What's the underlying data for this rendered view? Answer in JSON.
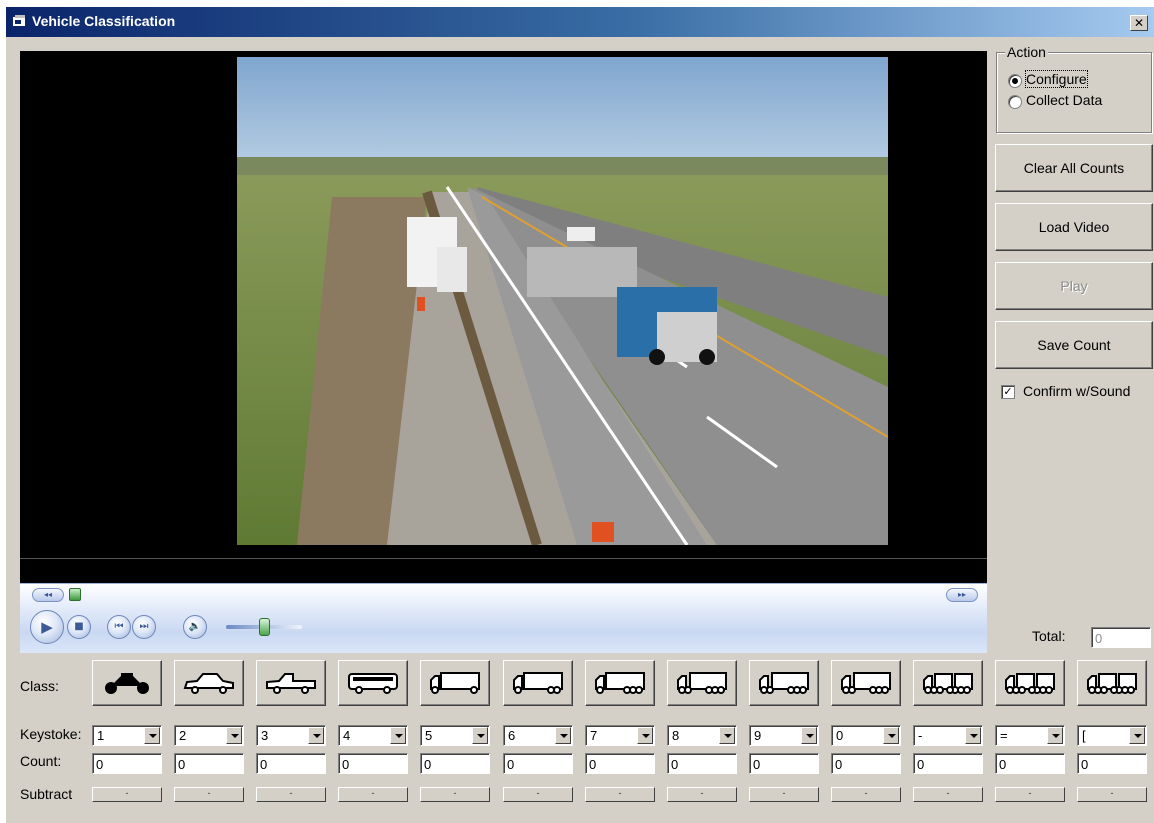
{
  "window": {
    "title": "Vehicle Classification",
    "close_glyph": "✕"
  },
  "action": {
    "legend": "Action",
    "options": [
      {
        "label": "Configure",
        "selected": true
      },
      {
        "label": "Collect Data",
        "selected": false
      }
    ]
  },
  "buttons": {
    "clear_all_counts": "Clear All Counts",
    "load_video": "Load Video",
    "play": "Play",
    "save_count": "Save Count"
  },
  "confirm_sound": {
    "label": "Confirm w/Sound",
    "checked": true
  },
  "total": {
    "label": "Total:",
    "value": "0"
  },
  "row_labels": {
    "class": "Class:",
    "keystroke": "Keystoke:",
    "count": "Count:",
    "subtract": "Subtract"
  },
  "classes": [
    {
      "icon": "motorcycle-icon",
      "key": "1",
      "count": "0",
      "subtract": "-"
    },
    {
      "icon": "car-icon",
      "key": "2",
      "count": "0",
      "subtract": "-"
    },
    {
      "icon": "pickup-truck-icon",
      "key": "3",
      "count": "0",
      "subtract": "-"
    },
    {
      "icon": "bus-icon",
      "key": "4",
      "count": "0",
      "subtract": "-"
    },
    {
      "icon": "single-unit-2-axle-truck-icon",
      "key": "5",
      "count": "0",
      "subtract": "-"
    },
    {
      "icon": "single-unit-3-axle-truck-icon",
      "key": "6",
      "count": "0",
      "subtract": "-"
    },
    {
      "icon": "single-unit-4-axle-truck-icon",
      "key": "7",
      "count": "0",
      "subtract": "-"
    },
    {
      "icon": "single-trailer-4-axle-truck-icon",
      "key": "8",
      "count": "0",
      "subtract": "-"
    },
    {
      "icon": "single-trailer-5-axle-truck-icon",
      "key": "9",
      "count": "0",
      "subtract": "-"
    },
    {
      "icon": "single-trailer-6-axle-truck-icon",
      "key": "0",
      "count": "0",
      "subtract": "-"
    },
    {
      "icon": "multi-trailer-5-axle-truck-icon",
      "key": "-",
      "count": "0",
      "subtract": "-"
    },
    {
      "icon": "multi-trailer-6-axle-truck-icon",
      "key": "=",
      "count": "0",
      "subtract": "-"
    },
    {
      "icon": "multi-trailer-7-axle-truck-icon",
      "key": "[",
      "count": "0",
      "subtract": "-"
    }
  ],
  "player": {
    "rewind_glyph": "◂◂",
    "forward_glyph": "▸▸",
    "play_glyph": "▶",
    "stop_glyph": "■",
    "prev_glyph": "⏮",
    "next_glyph": "⏭",
    "volume_glyph": "🔈"
  },
  "colors": {
    "title_gradient_start": "#0a246a",
    "face": "#d4d0c8",
    "player_accent": "#3b5a96"
  }
}
